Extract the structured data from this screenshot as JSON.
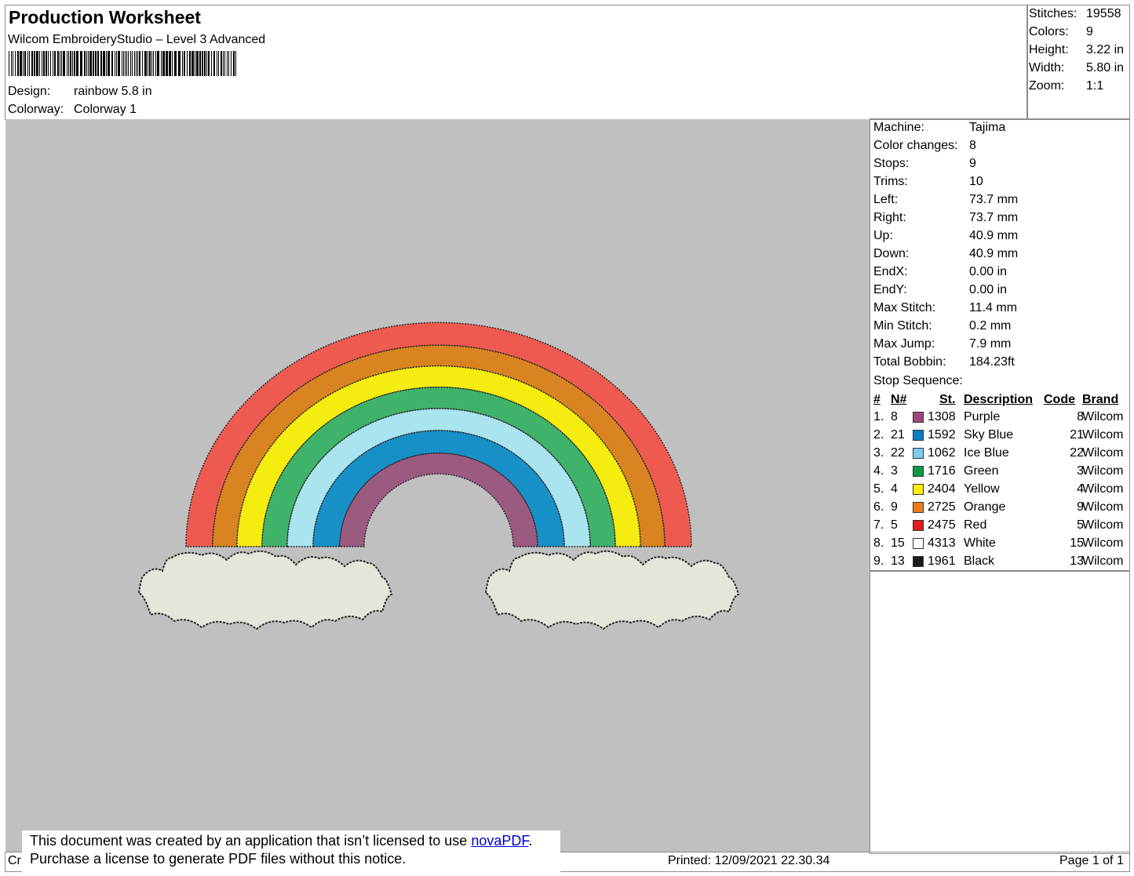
{
  "header": {
    "title": "Production Worksheet",
    "subtitle": "Wilcom EmbroideryStudio – Level 3 Advanced",
    "design_label": "Design:",
    "design_value": "rainbow 5.8 in",
    "colorway_label": "Colorway:",
    "colorway_value": "Colorway 1"
  },
  "summary": [
    {
      "label": "Stitches:",
      "value": "19558"
    },
    {
      "label": "Colors:",
      "value": "9"
    },
    {
      "label": "Height:",
      "value": "3.22 in"
    },
    {
      "label": "Width:",
      "value": "5.80 in"
    },
    {
      "label": "Zoom:",
      "value": "1:1"
    }
  ],
  "machine_info": [
    {
      "label": "Machine:",
      "value": "Tajima"
    },
    {
      "label": "Color changes:",
      "value": "8"
    },
    {
      "label": "Stops:",
      "value": "9"
    },
    {
      "label": "Trims:",
      "value": "10"
    },
    {
      "label": "Left:",
      "value": "73.7 mm"
    },
    {
      "label": "Right:",
      "value": "73.7 mm"
    },
    {
      "label": "Up:",
      "value": "40.9 mm"
    },
    {
      "label": "Down:",
      "value": "40.9 mm"
    },
    {
      "label": "EndX:",
      "value": "0.00 in"
    },
    {
      "label": "EndY:",
      "value": "0.00 in"
    },
    {
      "label": "Max Stitch:",
      "value": "11.4 mm"
    },
    {
      "label": "Min Stitch:",
      "value": "0.2 mm"
    },
    {
      "label": "Max Jump:",
      "value": "7.9 mm"
    },
    {
      "label": "Total Bobbin:",
      "value": "184.23ft"
    }
  ],
  "stop_sequence": {
    "title": "Stop Sequence:",
    "columns": {
      "num": "#",
      "needle": "N#",
      "st": "St.",
      "desc": "Description",
      "code": "Code",
      "brand": "Brand"
    },
    "rows": [
      {
        "num": "1.",
        "needle": "8",
        "color": "#a0457e",
        "st": "1308",
        "desc": "Purple",
        "code": "8",
        "brand": "Wilcom"
      },
      {
        "num": "2.",
        "needle": "21",
        "color": "#0a7fc4",
        "st": "1592",
        "desc": "Sky Blue",
        "code": "21",
        "brand": "Wilcom"
      },
      {
        "num": "3.",
        "needle": "22",
        "color": "#7ecbf0",
        "st": "1062",
        "desc": "Ice Blue",
        "code": "22",
        "brand": "Wilcom"
      },
      {
        "num": "4.",
        "needle": "3",
        "color": "#0a9a45",
        "st": "1716",
        "desc": "Green",
        "code": "3",
        "brand": "Wilcom"
      },
      {
        "num": "5.",
        "needle": "4",
        "color": "#ffee00",
        "st": "2404",
        "desc": "Yellow",
        "code": "4",
        "brand": "Wilcom"
      },
      {
        "num": "6.",
        "needle": "9",
        "color": "#ef7a1c",
        "st": "2725",
        "desc": "Orange",
        "code": "9",
        "brand": "Wilcom"
      },
      {
        "num": "7.",
        "needle": "5",
        "color": "#e21b1b",
        "st": "2475",
        "desc": "Red",
        "code": "5",
        "brand": "Wilcom"
      },
      {
        "num": "8.",
        "needle": "15",
        "color": "#ffffff",
        "st": "4313",
        "desc": "White",
        "code": "15",
        "brand": "Wilcom"
      },
      {
        "num": "9.",
        "needle": "13",
        "color": "#1a1a1a",
        "st": "1961",
        "desc": "Black",
        "code": "13",
        "brand": "Wilcom"
      }
    ]
  },
  "design_colors": {
    "red": "#ee5a50",
    "orange": "#d98420",
    "yellow": "#f5ec10",
    "green": "#3fb36a",
    "iceblue": "#a9e4ef",
    "skyblue": "#1790c8",
    "purple": "#9b5a80",
    "cloud": "#e4e6dc",
    "outline": "#2a2a2a",
    "canvas": "#c0c0c0"
  },
  "notice": {
    "line1_prefix": "This document was created by an application that isn’t licensed to use ",
    "line1_link": "novaPDF",
    "line1_suffix": ".",
    "line2": "Purchase a license to generate PDF files without this notice."
  },
  "footer": {
    "left": "Cr",
    "printed": "Printed: 12/09/2021 22.30.34",
    "page": "Page 1 of 1"
  }
}
